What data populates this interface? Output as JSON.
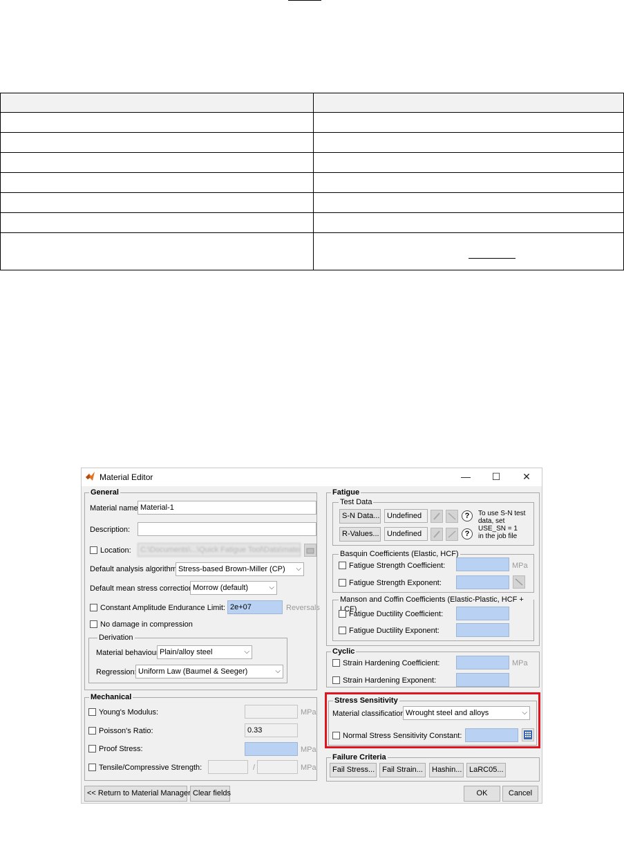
{
  "document": {
    "table_rows": 8
  },
  "window": {
    "title": "Material Editor",
    "minimize_glyph": "—",
    "maximize_glyph": "☐",
    "close_glyph": "✕"
  },
  "general": {
    "title": "General",
    "material_name_label": "Material name:",
    "material_name_value": "Material-1",
    "description_label": "Description:",
    "description_value": "",
    "location_label": "Location:",
    "location_value": "C:\\Documents\\...\\Quick Fatigue Tool\\Data\\material\\local",
    "analysis_algorithm_label": "Default analysis algorithm:",
    "analysis_algorithm_value": "Stress-based Brown-Miller (CP)",
    "mean_stress_label": "Default mean stress correction:",
    "mean_stress_value": "Morrow (default)",
    "cael_label": "Constant Amplitude Endurance Limit:",
    "cael_value": "2e+07",
    "cael_unit": "Reversals",
    "no_damage_label": "No damage in compression",
    "derivation": {
      "title": "Derivation",
      "behaviour_label": "Material behaviour:",
      "behaviour_value": "Plain/alloy steel",
      "regression_label": "Regression:",
      "regression_value": "Uniform Law (Baumel & Seeger)"
    }
  },
  "mechanical": {
    "title": "Mechanical",
    "youngs_label": "Young's Modulus:",
    "youngs_unit": "MPa",
    "poisson_label": "Poisson's Ratio:",
    "poisson_value": "0.33",
    "proof_label": "Proof Stress:",
    "proof_unit": "MPa",
    "tensile_label": "Tensile/Compressive Strength:",
    "tensile_sep": "/",
    "tensile_unit": "MPa"
  },
  "fatigue": {
    "title": "Fatigue",
    "test_data": {
      "title": "Test Data",
      "sn_button": "S-N Data...",
      "sn_status": "Undefined",
      "r_button": "R-Values...",
      "r_status": "Undefined",
      "help_glyph": "?",
      "note_lines": [
        "To use S-N test",
        "data, set",
        "USE_SN = 1",
        "in the job file"
      ]
    },
    "basquin": {
      "title": "Basquin Coefficients (Elastic, HCF)",
      "coef_label": "Fatigue Strength Coefficient:",
      "coef_unit": "MPa",
      "exp_label": "Fatigue Strength Exponent:"
    },
    "manson": {
      "title": "Manson and Coffin Coefficients (Elastic-Plastic, HCF + LCF)",
      "coef_label": "Fatigue Ductility Coefficient:",
      "exp_label": "Fatigue Ductility Exponent:"
    }
  },
  "cyclic": {
    "title": "Cyclic",
    "coef_label": "Strain Hardening Coefficient:",
    "coef_unit": "MPa",
    "exp_label": "Strain Hardening Exponent:"
  },
  "stress_sensitivity": {
    "title": "Stress Sensitivity",
    "classification_label": "Material classification:",
    "classification_value": "Wrought steel and alloys",
    "constant_label": "Normal Stress Sensitivity Constant:"
  },
  "failure": {
    "title": "Failure Criteria",
    "buttons": [
      "Fail Stress...",
      "Fail Strain...",
      "Hashin...",
      "LaRC05..."
    ]
  },
  "footer": {
    "return_button": "<< Return to Material Manager",
    "clear_button": "Clear fields",
    "ok_button": "OK",
    "cancel_button": "Cancel"
  },
  "colors": {
    "highlight": "#e0141e",
    "input_blue": "#b9d1f2",
    "window_bg": "#f0f0f0"
  }
}
